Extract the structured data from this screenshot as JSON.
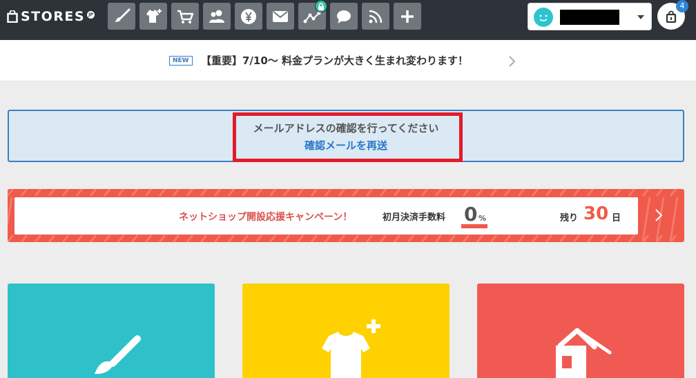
{
  "header": {
    "logo_text": "STORES",
    "logo_suffix": "JP",
    "nav_icons": [
      "brush-icon",
      "shirt-plus-icon",
      "cart-icon",
      "users-icon",
      "yen-icon",
      "mail-icon",
      "analytics-icon",
      "chat-icon",
      "rss-icon",
      "plus-icon"
    ],
    "notification_count": "4"
  },
  "announcement": {
    "badge": "NEW",
    "text": "【重要】7/10～ 料金プランが大きく生まれ変わります！"
  },
  "verify": {
    "message": "メールアドレスの確認を行ってください",
    "link": "確認メールを再送"
  },
  "campaign": {
    "title": "ネットショップ開設応援キャンペーン！",
    "fee_label": "初月決済手数料",
    "fee_value": "0",
    "fee_unit": "%",
    "remaining_label": "残り",
    "remaining_days": "30",
    "remaining_unit": "日"
  },
  "tiles": [
    {
      "name": "design",
      "color": "#2ec1c9",
      "icon": "brush-icon"
    },
    {
      "name": "items",
      "color": "#ffd100",
      "icon": "shirt-plus-icon"
    },
    {
      "name": "store",
      "color": "#f05a52",
      "icon": "house-icon"
    }
  ],
  "colors": {
    "header_bg": "#2d3339",
    "nav_button": "#6f767c",
    "accent_blue": "#2a78c8",
    "highlight_red": "#e21b2a",
    "campaign_red": "#f05a4a"
  }
}
